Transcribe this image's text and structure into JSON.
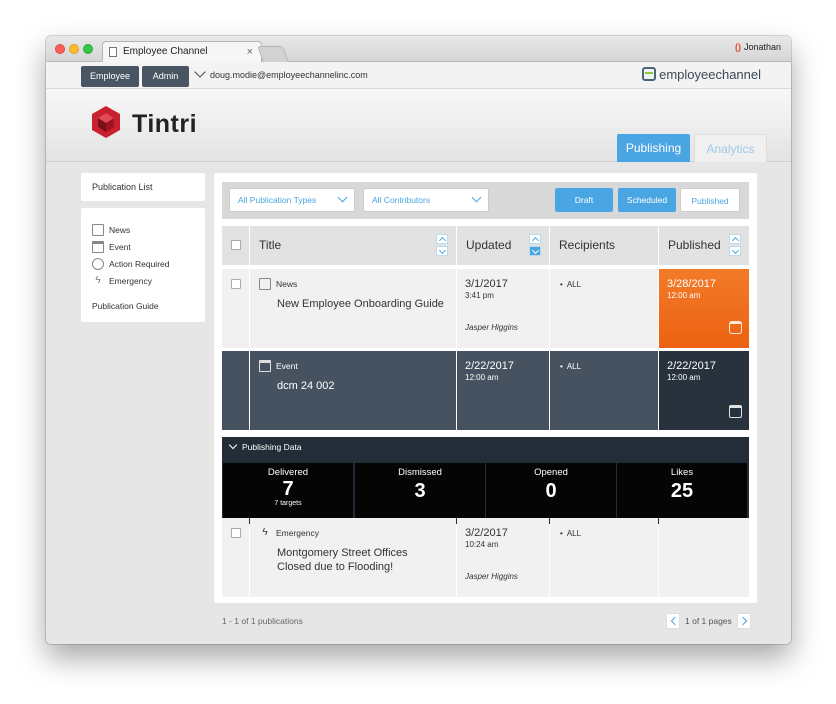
{
  "browser": {
    "tab_title": "Employee Channel",
    "tab_close": "×",
    "user": "Jonathan"
  },
  "toolbar": {
    "employee_label": "Employee",
    "admin_label": "Admin",
    "email": "doug.modie@employeechannelinc.com",
    "brand": "employeechannel"
  },
  "header": {
    "logo_text": "Tintri",
    "tabs": [
      {
        "label": "Publishing",
        "active": true
      },
      {
        "label": "Analytics",
        "active": false
      }
    ]
  },
  "sidebar": {
    "publication_list": "Publication List",
    "types": [
      {
        "label": "News",
        "icon": "news-icon"
      },
      {
        "label": "Event",
        "icon": "calendar-icon"
      },
      {
        "label": "Action Required",
        "icon": "check-circle-icon"
      },
      {
        "label": "Emergency",
        "icon": "lightning-icon"
      }
    ],
    "publication_guide": "Publication Guide"
  },
  "filters": {
    "types_select": "All Publication Types",
    "contributors_select": "All Contributors",
    "draft": "Draft",
    "scheduled": "Scheduled",
    "published": "Published"
  },
  "table": {
    "columns": [
      "Title",
      "Updated",
      "Recipients",
      "Published"
    ],
    "rows": [
      {
        "type": "News",
        "title": "New Employee Onboarding Guide",
        "updated_date": "3/1/2017",
        "updated_time": "3:41 pm",
        "updated_by": "Jasper Higgins",
        "recipients": "ALL",
        "published_date": "3/28/2017",
        "published_time": "12:00 am"
      },
      {
        "type": "Event",
        "title": "dcm 24 002",
        "updated_date": "2/22/2017",
        "updated_time": "12:00 am",
        "recipients": "ALL",
        "published_date": "2/22/2017",
        "published_time": "12:00 am"
      },
      {
        "type": "Emergency",
        "title_line1": "Montgomery Street Offices",
        "title_line2": "Closed due to Flooding!",
        "updated_date": "3/2/2017",
        "updated_time": "10:24 am",
        "updated_by": "Jasper Higgins",
        "recipients": "ALL"
      }
    ]
  },
  "publishing_data": {
    "header": "Publishing Data",
    "stats": [
      {
        "label": "Delivered",
        "value": "7",
        "sub": "7 targets"
      },
      {
        "label": "Dismissed",
        "value": "3"
      },
      {
        "label": "Opened",
        "value": "0"
      },
      {
        "label": "Likes",
        "value": "25"
      }
    ]
  },
  "footer": {
    "count": "1 - 1 of 1 publications",
    "pages": "1 of 1 pages"
  },
  "colors": {
    "accent": "#4aa6e2",
    "dark_button": "#4a5563",
    "published_orange": "#ec6212",
    "expanded_row": "#465260"
  }
}
